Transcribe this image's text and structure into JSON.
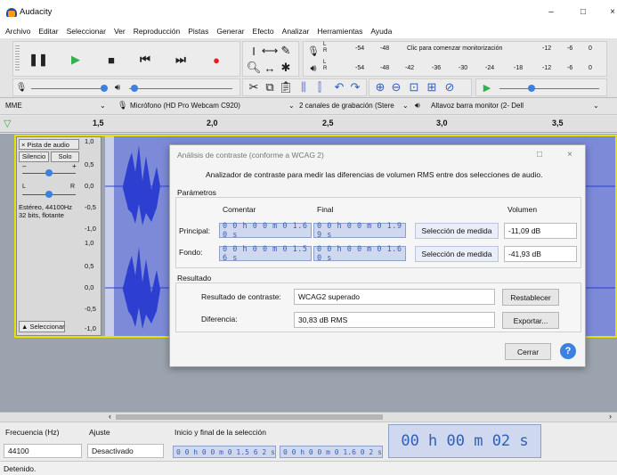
{
  "window": {
    "title": "Audacity",
    "minimize": "–",
    "maximize": "□",
    "close": "×"
  },
  "menu": [
    "Archivo",
    "Editar",
    "Seleccionar",
    "Ver",
    "Reproducción",
    "Pistas",
    "Generar",
    "Efecto",
    "Analizar",
    "Herramientas",
    "Ayuda"
  ],
  "meter": {
    "monitor_hint": "Clic para comenzar monitorización",
    "rec_ticks": [
      "-54",
      "-48",
      "-12",
      "-6",
      "0"
    ],
    "play_ticks": [
      "-54",
      "-48",
      "-42",
      "-36",
      "-30",
      "-24",
      "-18",
      "-12",
      "-6",
      "0"
    ],
    "l": "L",
    "r": "R"
  },
  "devices": {
    "host": "MME",
    "mic": "Micrófono (HD Pro Webcam C920)",
    "channels": "2 canales de grabación (Stere",
    "speaker": "Altavoz barra monitor (2- Dell"
  },
  "timeline": {
    "ticks": [
      "1,5",
      "2,0",
      "2,5",
      "3,0",
      "3,5"
    ]
  },
  "track": {
    "name": "Pista de audio",
    "mute": "Silencio",
    "solo": "Solo",
    "gain_minus": "–",
    "gain_plus": "+",
    "pan_l": "L",
    "pan_r": "R",
    "info_line1": "Estéreo, 44100Hz",
    "info_line2": "32 bits, flotante",
    "select": "Seleccionar",
    "scale_top": [
      "1,0",
      "0,5",
      "0,0",
      "-0,5",
      "-1,0"
    ],
    "scale_bottom": [
      "1,0",
      "0,5",
      "0,0",
      "-0,5",
      "-1,0"
    ]
  },
  "dialog": {
    "title": "Análisis de contraste (conforme a WCAG 2)",
    "description": "Analizador de contraste para medir las diferencias de volumen RMS entre dos selecciones de audio.",
    "params_label": "Parámetros",
    "col_start": "Comentar",
    "col_end": "Final",
    "col_volume": "Volumen",
    "rows": [
      {
        "label": "Principal:",
        "start": "0 0 h 0 0 m 0 1.6 0 s",
        "end": "0 0 h 0 0 m 0 1.9 9 s",
        "measure": "Selección de medida",
        "volume": "-11,09 dB"
      },
      {
        "label": "Fondo:",
        "start": "0 0 h 0 0 m 0 1.5 6 s",
        "end": "0 0 h 0 0 m 0 1.6 0 s",
        "measure": "Selección de medida",
        "volume": "-41,93 dB"
      }
    ],
    "result_label": "Resultado",
    "contrast_label": "Resultado de contraste:",
    "contrast_value": "WCAG2 superado",
    "diff_label": "Diferencia:",
    "diff_value": "30,83 dB RMS",
    "reset": "Restablecer",
    "export": "Exportar...",
    "close": "Cerrar",
    "help": "?"
  },
  "selection": {
    "rate_label": "Frecuencia (Hz)",
    "snap_label": "Ajuste",
    "rate_value": "44100",
    "snap_value": "Desactivado",
    "range_label": "Inicio y final de la selección",
    "start": "0 0 h 0 0 m 0 1.5 6 2 s",
    "end": "0 0 h 0 0 m 0 1.6 0 2 s",
    "big_time": "00 h 00 m 02 s"
  },
  "status": "Detenido."
}
